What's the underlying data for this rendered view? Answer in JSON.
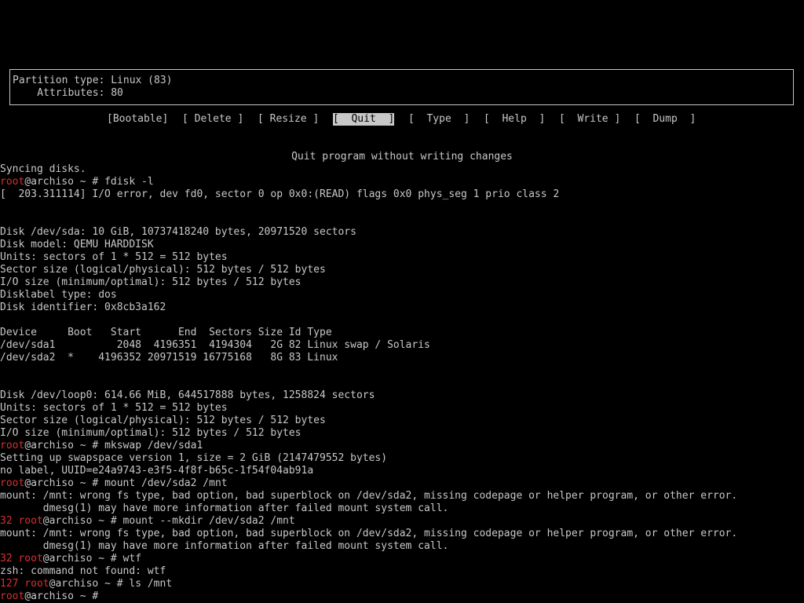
{
  "partition_box": {
    "type_line": "Partition type: Linux (83)",
    "attr_line": "    Attributes: 80"
  },
  "menu": {
    "items": [
      {
        "label": "[Bootable]",
        "selected": false
      },
      {
        "label": "[ Delete ]",
        "selected": false
      },
      {
        "label": "[ Resize ]",
        "selected": false
      },
      {
        "label": "[  Quit  ]",
        "selected": true
      },
      {
        "label": "[  Type  ]",
        "selected": false
      },
      {
        "label": "[  Help  ]",
        "selected": false
      },
      {
        "label": "[  Write ]",
        "selected": false
      },
      {
        "label": "[  Dump  ]",
        "selected": false
      }
    ],
    "description": "Quit program without writing changes"
  },
  "terminal": {
    "prompt_user": "root",
    "prompt_rest": "@archiso ~ # ",
    "lines": [
      {
        "text": "Syncing disks."
      },
      {
        "prompt": true,
        "cmd": "fdisk -l"
      },
      {
        "text": "[  203.311114] I/O error, dev fd0, sector 0 op 0x0:(READ) flags 0x0 phys_seg 1 prio class 2"
      },
      {
        "text": ""
      },
      {
        "text": ""
      },
      {
        "text": "Disk /dev/sda: 10 GiB, 10737418240 bytes, 20971520 sectors",
        "bold": true
      },
      {
        "text": "Disk model: QEMU HARDDISK"
      },
      {
        "text": "Units: sectors of 1 * 512 = 512 bytes"
      },
      {
        "text": "Sector size (logical/physical): 512 bytes / 512 bytes"
      },
      {
        "text": "I/O size (minimum/optimal): 512 bytes / 512 bytes"
      },
      {
        "text": "Disklabel type: dos"
      },
      {
        "text": "Disk identifier: 0x8cb3a162"
      },
      {
        "text": ""
      },
      {
        "text": "Device     Boot   Start      End  Sectors Size Id Type",
        "bold": true
      },
      {
        "text": "/dev/sda1          2048  4196351  4194304   2G 82 Linux swap / Solaris"
      },
      {
        "text": "/dev/sda2  *    4196352 20971519 16775168   8G 83 Linux"
      },
      {
        "text": ""
      },
      {
        "text": ""
      },
      {
        "text": "Disk /dev/loop0: 614.66 MiB, 644517888 bytes, 1258824 sectors",
        "bold": true
      },
      {
        "text": "Units: sectors of 1 * 512 = 512 bytes"
      },
      {
        "text": "Sector size (logical/physical): 512 bytes / 512 bytes"
      },
      {
        "text": "I/O size (minimum/optimal): 512 bytes / 512 bytes"
      },
      {
        "prompt": true,
        "cmd": "mkswap /dev/sda1"
      },
      {
        "text": "Setting up swapspace version 1, size = 2 GiB (2147479552 bytes)"
      },
      {
        "text": "no label, UUID=e24a9743-e3f5-4f8f-b65c-1f54f04ab91a"
      },
      {
        "prompt": true,
        "cmd": "mount /dev/sda2 /mnt"
      },
      {
        "text": "mount: /mnt: wrong fs type, bad option, bad superblock on /dev/sda2, missing codepage or helper program, or other error."
      },
      {
        "text": "       dmesg(1) may have more information after failed mount system call."
      },
      {
        "prompt": true,
        "code": "32",
        "cmd": "mount --mkdir /dev/sda2 /mnt"
      },
      {
        "text": "mount: /mnt: wrong fs type, bad option, bad superblock on /dev/sda2, missing codepage or helper program, or other error."
      },
      {
        "text": "       dmesg(1) may have more information after failed mount system call."
      },
      {
        "prompt": true,
        "code": "32",
        "cmd": "wtf"
      },
      {
        "text": "zsh: command not found: wtf"
      },
      {
        "prompt": true,
        "code": "127",
        "cmd": "ls /mnt"
      },
      {
        "prompt": true,
        "cmd": "",
        "cursor": false
      }
    ]
  },
  "colors": {
    "fg": "#c8c8c8",
    "bg": "#000000",
    "prompt_red": "#d83030"
  }
}
